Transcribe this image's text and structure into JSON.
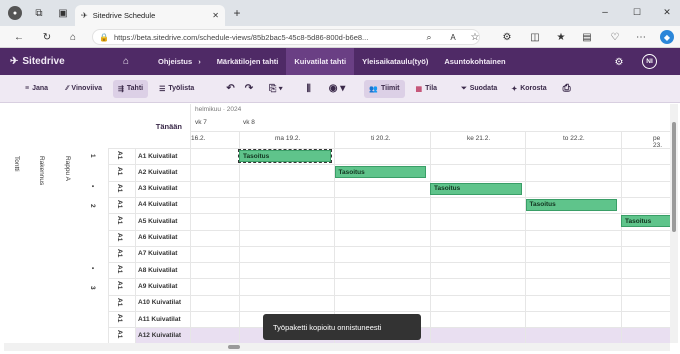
{
  "browser": {
    "tab_title": "Sitedrive Schedule",
    "url": "https://beta.sitedrive.com/schedule-views/85b2bac5-45c8-5d86-800d-b6e8..."
  },
  "app": {
    "logo": "Sitedrive",
    "nav": [
      "Ohjeistus",
      "Märkätilojen tahti",
      "Kuivatilat tahti",
      "Yleisaikataulu(työ)",
      "Asuntokohtainen"
    ],
    "active_nav": "Kuivatilat tahti",
    "avatar": "NI"
  },
  "toolbar": {
    "jana": "Jana",
    "vinoviiva": "Vinoviiva",
    "tahti": "Tahti",
    "tyolista": "Työlista",
    "tiimit": "Tiimit",
    "tila": "Tila",
    "suodata": "Suodata",
    "korosta": "Korosta"
  },
  "timeline": {
    "today_label": "Tänään",
    "month": "helmikuu · 2024",
    "weeks": [
      "vk 7",
      "vk 8"
    ],
    "days": [
      "16.2.",
      "ma 19.2.",
      "ti 20.2.",
      "ke 21.2.",
      "to 22.2.",
      "pe 23."
    ]
  },
  "hierarchy": {
    "level1": "Tontti",
    "level2": "Rakennus",
    "level3": "Rappu A",
    "floors": [
      "1",
      "2",
      "3"
    ],
    "dots": [
      "•",
      "•"
    ],
    "unit_marks": [
      "A1",
      "A1",
      "A1",
      "A1",
      "A1",
      "A1",
      "A1",
      "A1",
      "A1",
      "A1",
      "A1",
      "A1"
    ]
  },
  "rows": [
    "A1 Kuivatilat",
    "A2 Kuivatilat",
    "A3 Kuivatilat",
    "A4 Kuivatilat",
    "A5 Kuivatilat",
    "A6 Kuivatilat",
    "A7 Kuivatilat",
    "A8 Kuivatilat",
    "A9 Kuivatilat",
    "A10 Kuivatilat",
    "A11 Kuivatilat",
    "A12 Kuivatilat"
  ],
  "tasks": [
    {
      "label": "Tasoitus",
      "row": 0,
      "day": 1
    },
    {
      "label": "Tasoitus",
      "row": 1,
      "day": 2
    },
    {
      "label": "Tasoitus",
      "row": 2,
      "day": 3
    },
    {
      "label": "Tasoitus",
      "row": 3,
      "day": 4
    },
    {
      "label": "Tasoitus",
      "row": 4,
      "day": 5
    }
  ],
  "toast": "Työpaketti kopioitu onnistuneesti",
  "colors": {
    "nav_bg": "#4f2a66",
    "task_green": "#5fc48b",
    "selected_row": "#e9dff1"
  }
}
